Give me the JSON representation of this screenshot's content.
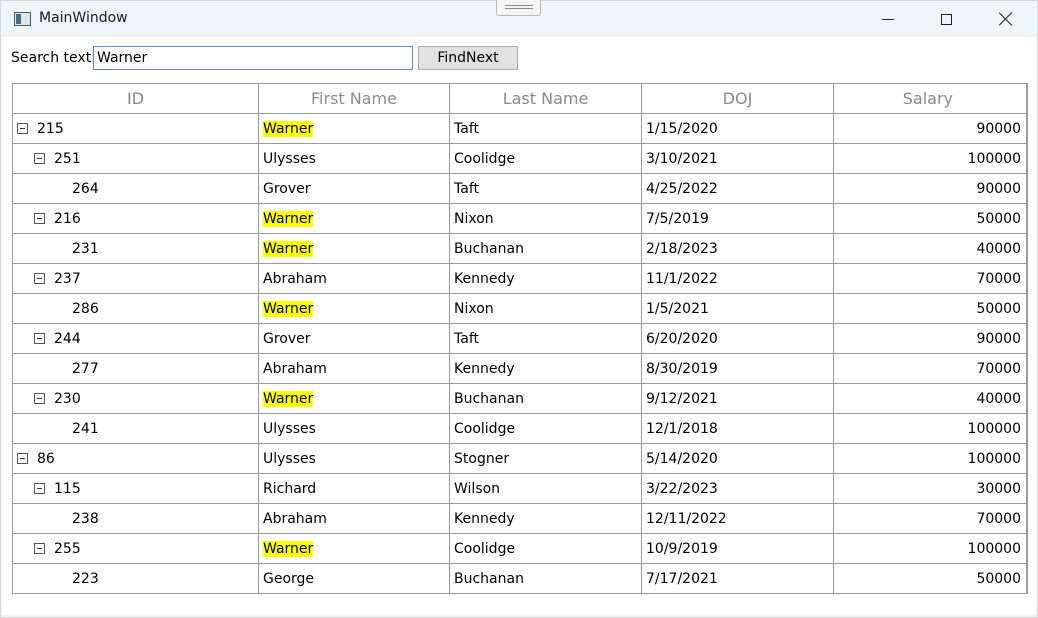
{
  "window": {
    "title": "MainWindow",
    "icon": "app-window-icon"
  },
  "search": {
    "label": "Search text:",
    "value": "Warner",
    "find_next_label": "FindNext"
  },
  "grid": {
    "columns": [
      "ID",
      "First Name",
      "Last Name",
      "DOJ",
      "Salary"
    ],
    "highlight_color": "#ffff00",
    "rows": [
      {
        "level": 0,
        "expander": true,
        "id": "215",
        "first": "Warner",
        "last": "Taft",
        "doj": "1/15/2020",
        "salary": "90000",
        "match": true
      },
      {
        "level": 1,
        "expander": true,
        "id": "251",
        "first": "Ulysses",
        "last": "Coolidge",
        "doj": "3/10/2021",
        "salary": "100000",
        "match": false
      },
      {
        "level": 2,
        "expander": false,
        "id": "264",
        "first": "Grover",
        "last": "Taft",
        "doj": "4/25/2022",
        "salary": "90000",
        "match": false
      },
      {
        "level": 1,
        "expander": true,
        "id": "216",
        "first": "Warner",
        "last": "Nixon",
        "doj": "7/5/2019",
        "salary": "50000",
        "match": true
      },
      {
        "level": 2,
        "expander": false,
        "id": "231",
        "first": "Warner",
        "last": "Buchanan",
        "doj": "2/18/2023",
        "salary": "40000",
        "match": true
      },
      {
        "level": 1,
        "expander": true,
        "id": "237",
        "first": "Abraham",
        "last": "Kennedy",
        "doj": "11/1/2022",
        "salary": "70000",
        "match": false
      },
      {
        "level": 2,
        "expander": false,
        "id": "286",
        "first": "Warner",
        "last": "Nixon",
        "doj": "1/5/2021",
        "salary": "50000",
        "match": true
      },
      {
        "level": 1,
        "expander": true,
        "id": "244",
        "first": "Grover",
        "last": "Taft",
        "doj": "6/20/2020",
        "salary": "90000",
        "match": false
      },
      {
        "level": 2,
        "expander": false,
        "id": "277",
        "first": "Abraham",
        "last": "Kennedy",
        "doj": "8/30/2019",
        "salary": "70000",
        "match": false
      },
      {
        "level": 1,
        "expander": true,
        "id": "230",
        "first": "Warner",
        "last": "Buchanan",
        "doj": "9/12/2021",
        "salary": "40000",
        "match": true
      },
      {
        "level": 2,
        "expander": false,
        "id": "241",
        "first": "Ulysses",
        "last": "Coolidge",
        "doj": "12/1/2018",
        "salary": "100000",
        "match": false
      },
      {
        "level": 0,
        "expander": true,
        "id": "86",
        "first": "Ulysses",
        "last": "Stogner",
        "doj": "5/14/2020",
        "salary": "100000",
        "match": false
      },
      {
        "level": 1,
        "expander": true,
        "id": "115",
        "first": "Richard",
        "last": "Wilson",
        "doj": "3/22/2023",
        "salary": "30000",
        "match": false
      },
      {
        "level": 2,
        "expander": false,
        "id": "238",
        "first": "Abraham",
        "last": "Kennedy",
        "doj": "12/11/2022",
        "salary": "70000",
        "match": false
      },
      {
        "level": 1,
        "expander": true,
        "id": "255",
        "first": "Warner",
        "last": "Coolidge",
        "doj": "10/9/2019",
        "salary": "100000",
        "match": true
      },
      {
        "level": 2,
        "expander": false,
        "id": "223",
        "first": "George",
        "last": "Buchanan",
        "doj": "7/17/2021",
        "salary": "50000",
        "match": false
      }
    ]
  }
}
